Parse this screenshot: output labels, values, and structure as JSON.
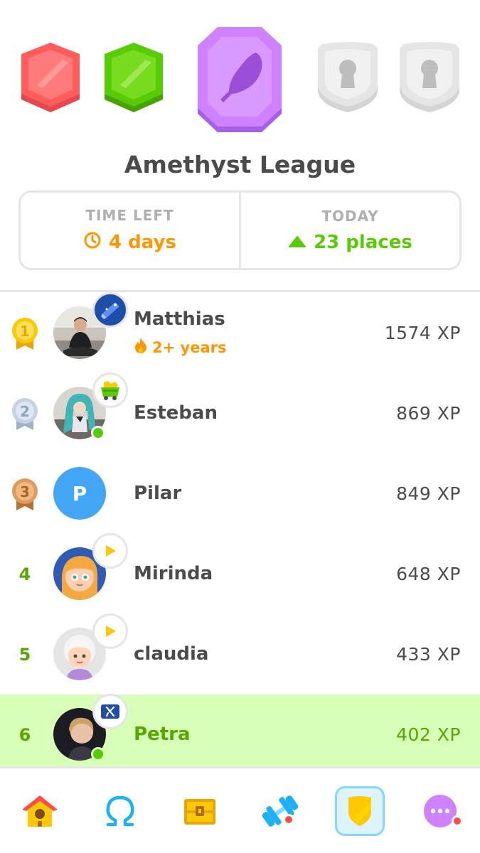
{
  "league": {
    "title": "Amethyst League",
    "badges": [
      {
        "name": "red-league-badge",
        "color": "#ff4b4b",
        "state": "unlocked"
      },
      {
        "name": "green-league-badge",
        "color": "#58cc02",
        "state": "unlocked"
      },
      {
        "name": "amethyst-league-badge",
        "color": "#ce82ff",
        "state": "current"
      },
      {
        "name": "locked-league-badge",
        "color": "#e5e5e5",
        "state": "locked"
      },
      {
        "name": "locked-league-badge",
        "color": "#e5e5e5",
        "state": "locked"
      }
    ]
  },
  "info": {
    "time_left_label": "TIME LEFT",
    "time_left_value": "4 days",
    "today_label": "TODAY",
    "today_value": "23 places"
  },
  "leaderboard": [
    {
      "rank": "1",
      "medal": "gold",
      "name": "Matthias",
      "streak": "2+ years",
      "xp": "1574 XP",
      "flair": "scroll-icon"
    },
    {
      "rank": "2",
      "medal": "silver",
      "name": "Esteban",
      "xp": "869 XP",
      "flair": "treasure-cart-icon",
      "online": true
    },
    {
      "rank": "3",
      "medal": "bronze",
      "name": "Pilar",
      "avatar_letter": "P",
      "xp": "849 XP"
    },
    {
      "rank": "4",
      "name": "Mirinda",
      "xp": "648 XP",
      "flair": "play-icon"
    },
    {
      "rank": "5",
      "name": "claudia",
      "xp": "433 XP",
      "flair": "play-icon"
    },
    {
      "rank": "6",
      "name": "Petra",
      "xp": "402 XP",
      "flair": "hebrew-flag-icon",
      "online": true,
      "current_user": true
    }
  ],
  "colors": {
    "accent_green": "#58cc02",
    "accent_orange": "#ff9600",
    "highlight_row": "#d7ffb8",
    "text": "#4b4b4b",
    "muted": "#afafaf"
  },
  "nav": [
    {
      "icon": "home-icon",
      "active": false
    },
    {
      "icon": "omega-icon",
      "active": false
    },
    {
      "icon": "treasure-chest-icon",
      "active": false
    },
    {
      "icon": "dumbbell-icon",
      "active": false,
      "notification": true
    },
    {
      "icon": "league-shield-icon",
      "active": true
    },
    {
      "icon": "more-icon",
      "active": false,
      "notification": true
    }
  ]
}
